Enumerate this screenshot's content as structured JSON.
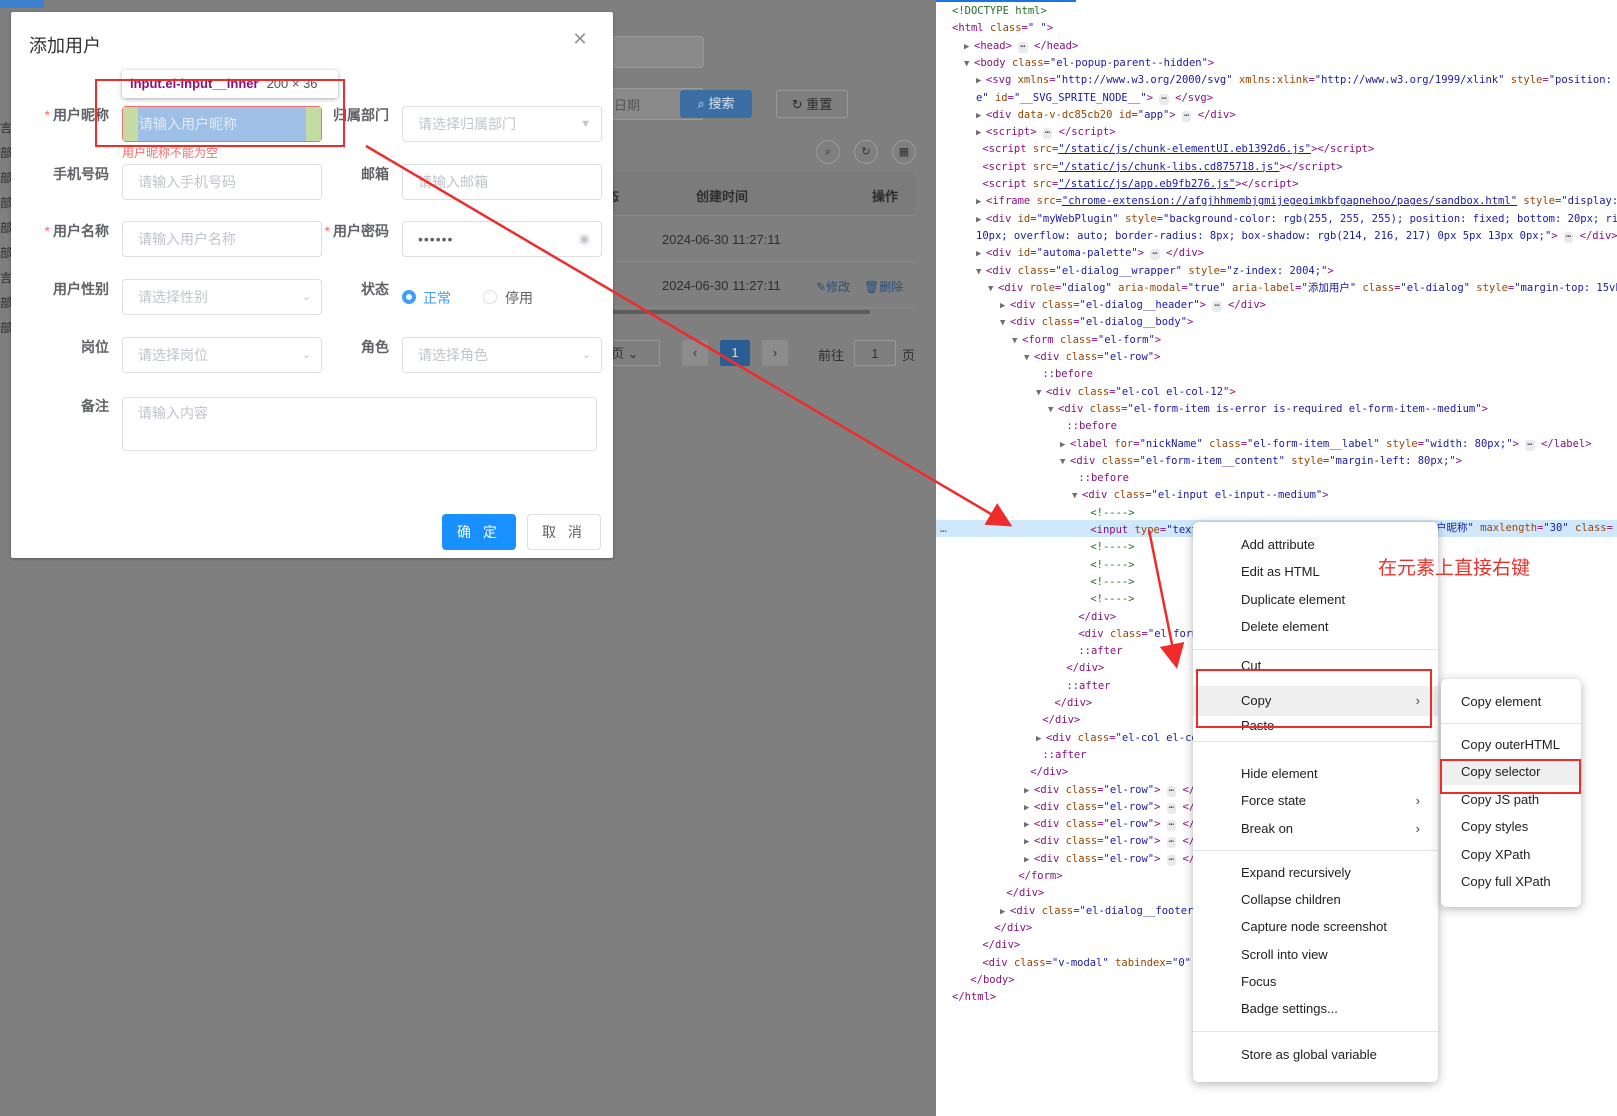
{
  "background_page": {
    "search_button": "搜索",
    "reset_button": "重置",
    "end_date_placeholder": "束日期",
    "columns": [
      "态",
      "创建时间",
      "操作"
    ],
    "rows": [
      {
        "created": "2024-06-30 11:27:11",
        "actions": []
      },
      {
        "created": "2024-06-30 11:27:11",
        "actions": [
          "修改",
          "删除"
        ]
      }
    ],
    "pagination": {
      "page_suffix": "页",
      "current": "1",
      "goto_label": "前往",
      "goto_value": "1",
      "goto_suffix": "页"
    },
    "sidebar_chars": [
      "言",
      "部",
      "部",
      "部",
      "部",
      "部",
      "言",
      "部",
      "部"
    ]
  },
  "dialog": {
    "title": "添加用户",
    "tooltip": {
      "selector": "input.el-input__inner",
      "size": "200 × 36"
    },
    "fields": {
      "nickname": {
        "label": "用户昵称",
        "placeholder": "请输入用户昵称",
        "error": "用户昵称不能为空"
      },
      "dept": {
        "label": "归属部门",
        "placeholder": "请选择归属部门"
      },
      "phone": {
        "label": "手机号码",
        "placeholder": "请输入手机号码"
      },
      "email": {
        "label": "邮箱",
        "placeholder": "请输入邮箱"
      },
      "username": {
        "label": "用户名称",
        "placeholder": "请输入用户名称"
      },
      "password": {
        "label": "用户密码",
        "value": "••••••"
      },
      "gender": {
        "label": "用户性别",
        "placeholder": "请选择性别"
      },
      "status": {
        "label": "状态",
        "options": [
          "正常",
          "停用"
        ],
        "selected": "正常"
      },
      "post": {
        "label": "岗位",
        "placeholder": "请选择岗位"
      },
      "role": {
        "label": "角色",
        "placeholder": "请选择角色"
      },
      "remark": {
        "label": "备注",
        "placeholder": "请输入内容"
      }
    },
    "confirm_button": "确 定",
    "cancel_button": "取 消"
  },
  "annotation": "在元素上直接右键",
  "context_menu": {
    "items": [
      "Add attribute",
      "Edit as HTML",
      "Duplicate element",
      "Delete element",
      "Cut",
      "Copy",
      "Paste",
      "Hide element",
      "Force state",
      "Break on",
      "Expand recursively",
      "Collapse children",
      "Capture node screenshot",
      "Scroll into view",
      "Focus",
      "Badge settings...",
      "Store as global variable"
    ]
  },
  "copy_submenu": {
    "items": [
      "Copy element",
      "Copy outerHTML",
      "Copy selector",
      "Copy JS path",
      "Copy styles",
      "Copy XPath",
      "Copy full XPath"
    ]
  },
  "colors": {
    "highlight_red": "#f02b2b",
    "primary": "#1890ff",
    "error": "#f56c6c"
  }
}
